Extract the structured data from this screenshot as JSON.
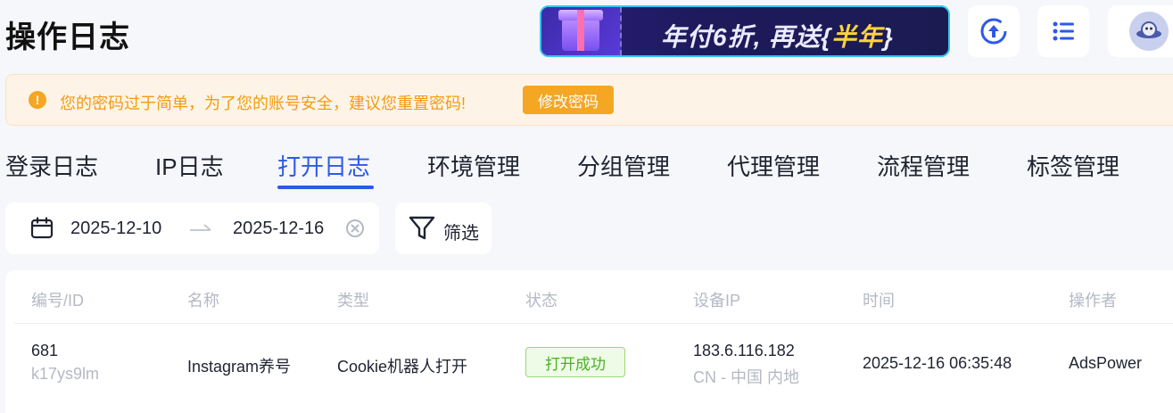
{
  "header": {
    "title": "操作日志",
    "promo": {
      "text_before": "年付6折, 再送{",
      "highlight": "半年",
      "text_after": "}"
    }
  },
  "warning": {
    "message": "您的密码过于简单，为了您的账号安全，建议您重置密码!",
    "button_label": "修改密码"
  },
  "tabs": [
    {
      "label": "登录日志",
      "active": false
    },
    {
      "label": "IP日志",
      "active": false
    },
    {
      "label": "打开日志",
      "active": true
    },
    {
      "label": "环境管理",
      "active": false
    },
    {
      "label": "分组管理",
      "active": false
    },
    {
      "label": "代理管理",
      "active": false
    },
    {
      "label": "流程管理",
      "active": false
    },
    {
      "label": "标签管理",
      "active": false
    }
  ],
  "filters": {
    "start_date": "2025-12-10",
    "end_date": "2025-12-16",
    "filter_label": "筛选"
  },
  "table": {
    "columns": [
      "编号/ID",
      "名称",
      "类型",
      "状态",
      "设备IP",
      "时间",
      "操作者"
    ],
    "rows": [
      {
        "id": "681",
        "code": "k17ys9lm",
        "name": "Instagram养号",
        "type": "Cookie机器人打开",
        "status": "打开成功",
        "ip": "183.6.116.182",
        "location": "CN - 中国 内地",
        "time": "2025-12-16 06:35:48",
        "operator": "AdsPower"
      }
    ]
  },
  "colors": {
    "accent": "#2e59e6",
    "warning": "#f5a623",
    "success": "#4caf27"
  }
}
